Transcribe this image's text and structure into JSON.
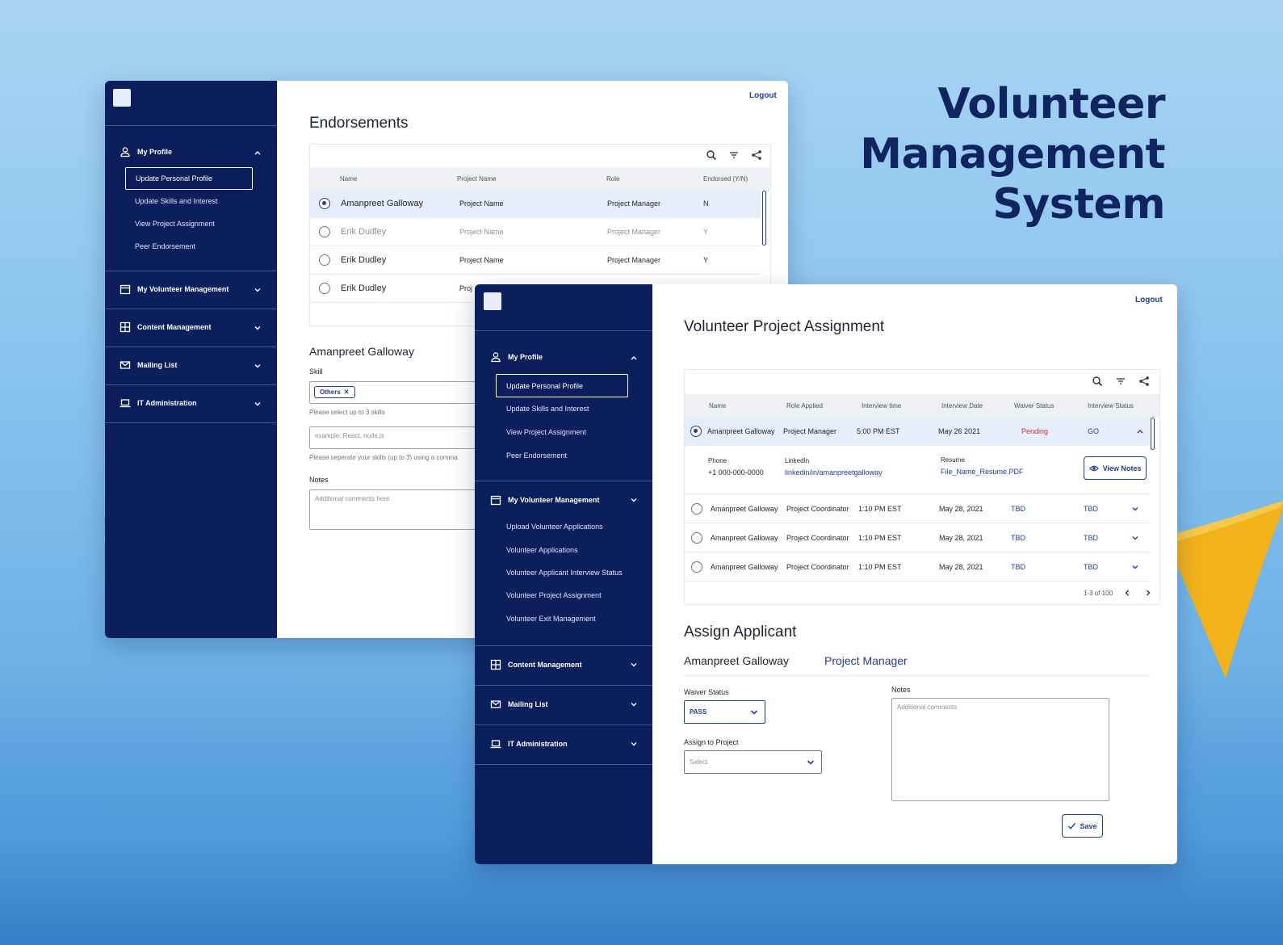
{
  "hero": {
    "line1": "Volunteer",
    "line2": "Management",
    "line3": "System"
  },
  "colors": {
    "navy": "#0b1f5c",
    "accent": "#1f3f98",
    "pending": "#d3332a",
    "boat": "#f2b21b"
  },
  "w1": {
    "logout": "Logout",
    "sidebar": {
      "my_profile": "My Profile",
      "items": [
        "Update Personal Profile",
        "Update Skills and Interest",
        "View Project Assignment",
        "Peer Endorsement"
      ],
      "sections": [
        "My Volunteer Management",
        "Content Management",
        "Mailing List",
        "IT Administration"
      ]
    },
    "title": "Endorsements",
    "table": {
      "headers": [
        "Name",
        "Project Name",
        "Role",
        "Endorsed (Y/N)"
      ],
      "rows": [
        {
          "name": "Amanpreet Galloway",
          "project": "Project Name",
          "role": "Project Manager",
          "endorsed": "N"
        },
        {
          "name": "Erik Dudley",
          "project": "Project Name",
          "role": "Project Manager",
          "endorsed": "Y"
        },
        {
          "name": "Erik Dudley",
          "project": "Project Name",
          "role": "Project Manager",
          "endorsed": "Y"
        },
        {
          "name": "Erik Dudley",
          "project": "Proj",
          "role": "",
          "endorsed": ""
        }
      ]
    },
    "form": {
      "person": "Amanpreet Galloway",
      "skill_label": "Skill",
      "chip": "Others",
      "skill_hint": "Please select up to 3 skills",
      "skills_placeholder": "example: React, node.js",
      "skills_hint": "Please seperate your skills (up to 3) using a comma.",
      "notes_label": "Notes",
      "notes_placeholder": "Additional comments here"
    }
  },
  "w2": {
    "logout": "Logout",
    "sidebar": {
      "my_profile": "My Profile",
      "profile_items": [
        "Update Personal Profile",
        "Update Skills and Interest",
        "View Project Assignment",
        "Peer Endorsement"
      ],
      "vm_head": "My Volunteer Management",
      "vm_items": [
        "Upload Volunteer Applications",
        "Volunteer Applications",
        "Volunteer Applicant Interview Status",
        "Volunteer Project Assignment",
        "Volunteer Exit Management"
      ],
      "sections": [
        "Content Management",
        "Mailing List",
        "IT Administration"
      ]
    },
    "title": "Volunteer Project Assignment",
    "table": {
      "headers": [
        "Name",
        "Role Applied",
        "Interview time",
        "Interview Date",
        "Waiver Status",
        "Interview Status"
      ],
      "rows": [
        {
          "name": "Amanpreet Galloway",
          "role": "Project Manager",
          "time": "5:00 PM EST",
          "date": "May 26 2021",
          "waiver": "Pending",
          "status": "GO"
        },
        {
          "name": "Amanpreet Galloway",
          "role": "Project Coordinator",
          "time": "1:10 PM EST",
          "date": "May 28, 2021",
          "waiver": "TBD",
          "status": "TBD"
        },
        {
          "name": "Amanpreet Galloway",
          "role": "Project Coordinator",
          "time": "1:10 PM EST",
          "date": "May 28, 2021",
          "waiver": "TBD",
          "status": "TBD"
        },
        {
          "name": "Amanpreet Galloway",
          "role": "Project Coordinator",
          "time": "1:10 PM EST",
          "date": "May 28, 2021",
          "waiver": "TBD",
          "status": "TBD"
        }
      ],
      "detail": {
        "phone_label": "Phone",
        "phone": "+1 000-000-0000",
        "linkedin_label": "LinkedIn",
        "linkedin": "linkedin/in/amanpreetgalloway",
        "resume_label": "Resume",
        "resume": "File_Name_Resume.PDF",
        "view_notes": "View Notes"
      },
      "pagination": "1-3 of 100"
    },
    "assign": {
      "title": "Assign Applicant",
      "person": "Amanpreet Galloway",
      "role": "Project Manager",
      "waiver_label": "Waiver Status",
      "waiver_value": "PASS",
      "project_label": "Assign to Project",
      "project_value": "Select",
      "notes_label": "Notes",
      "notes_placeholder": "Additional comments",
      "save": "Save"
    }
  }
}
